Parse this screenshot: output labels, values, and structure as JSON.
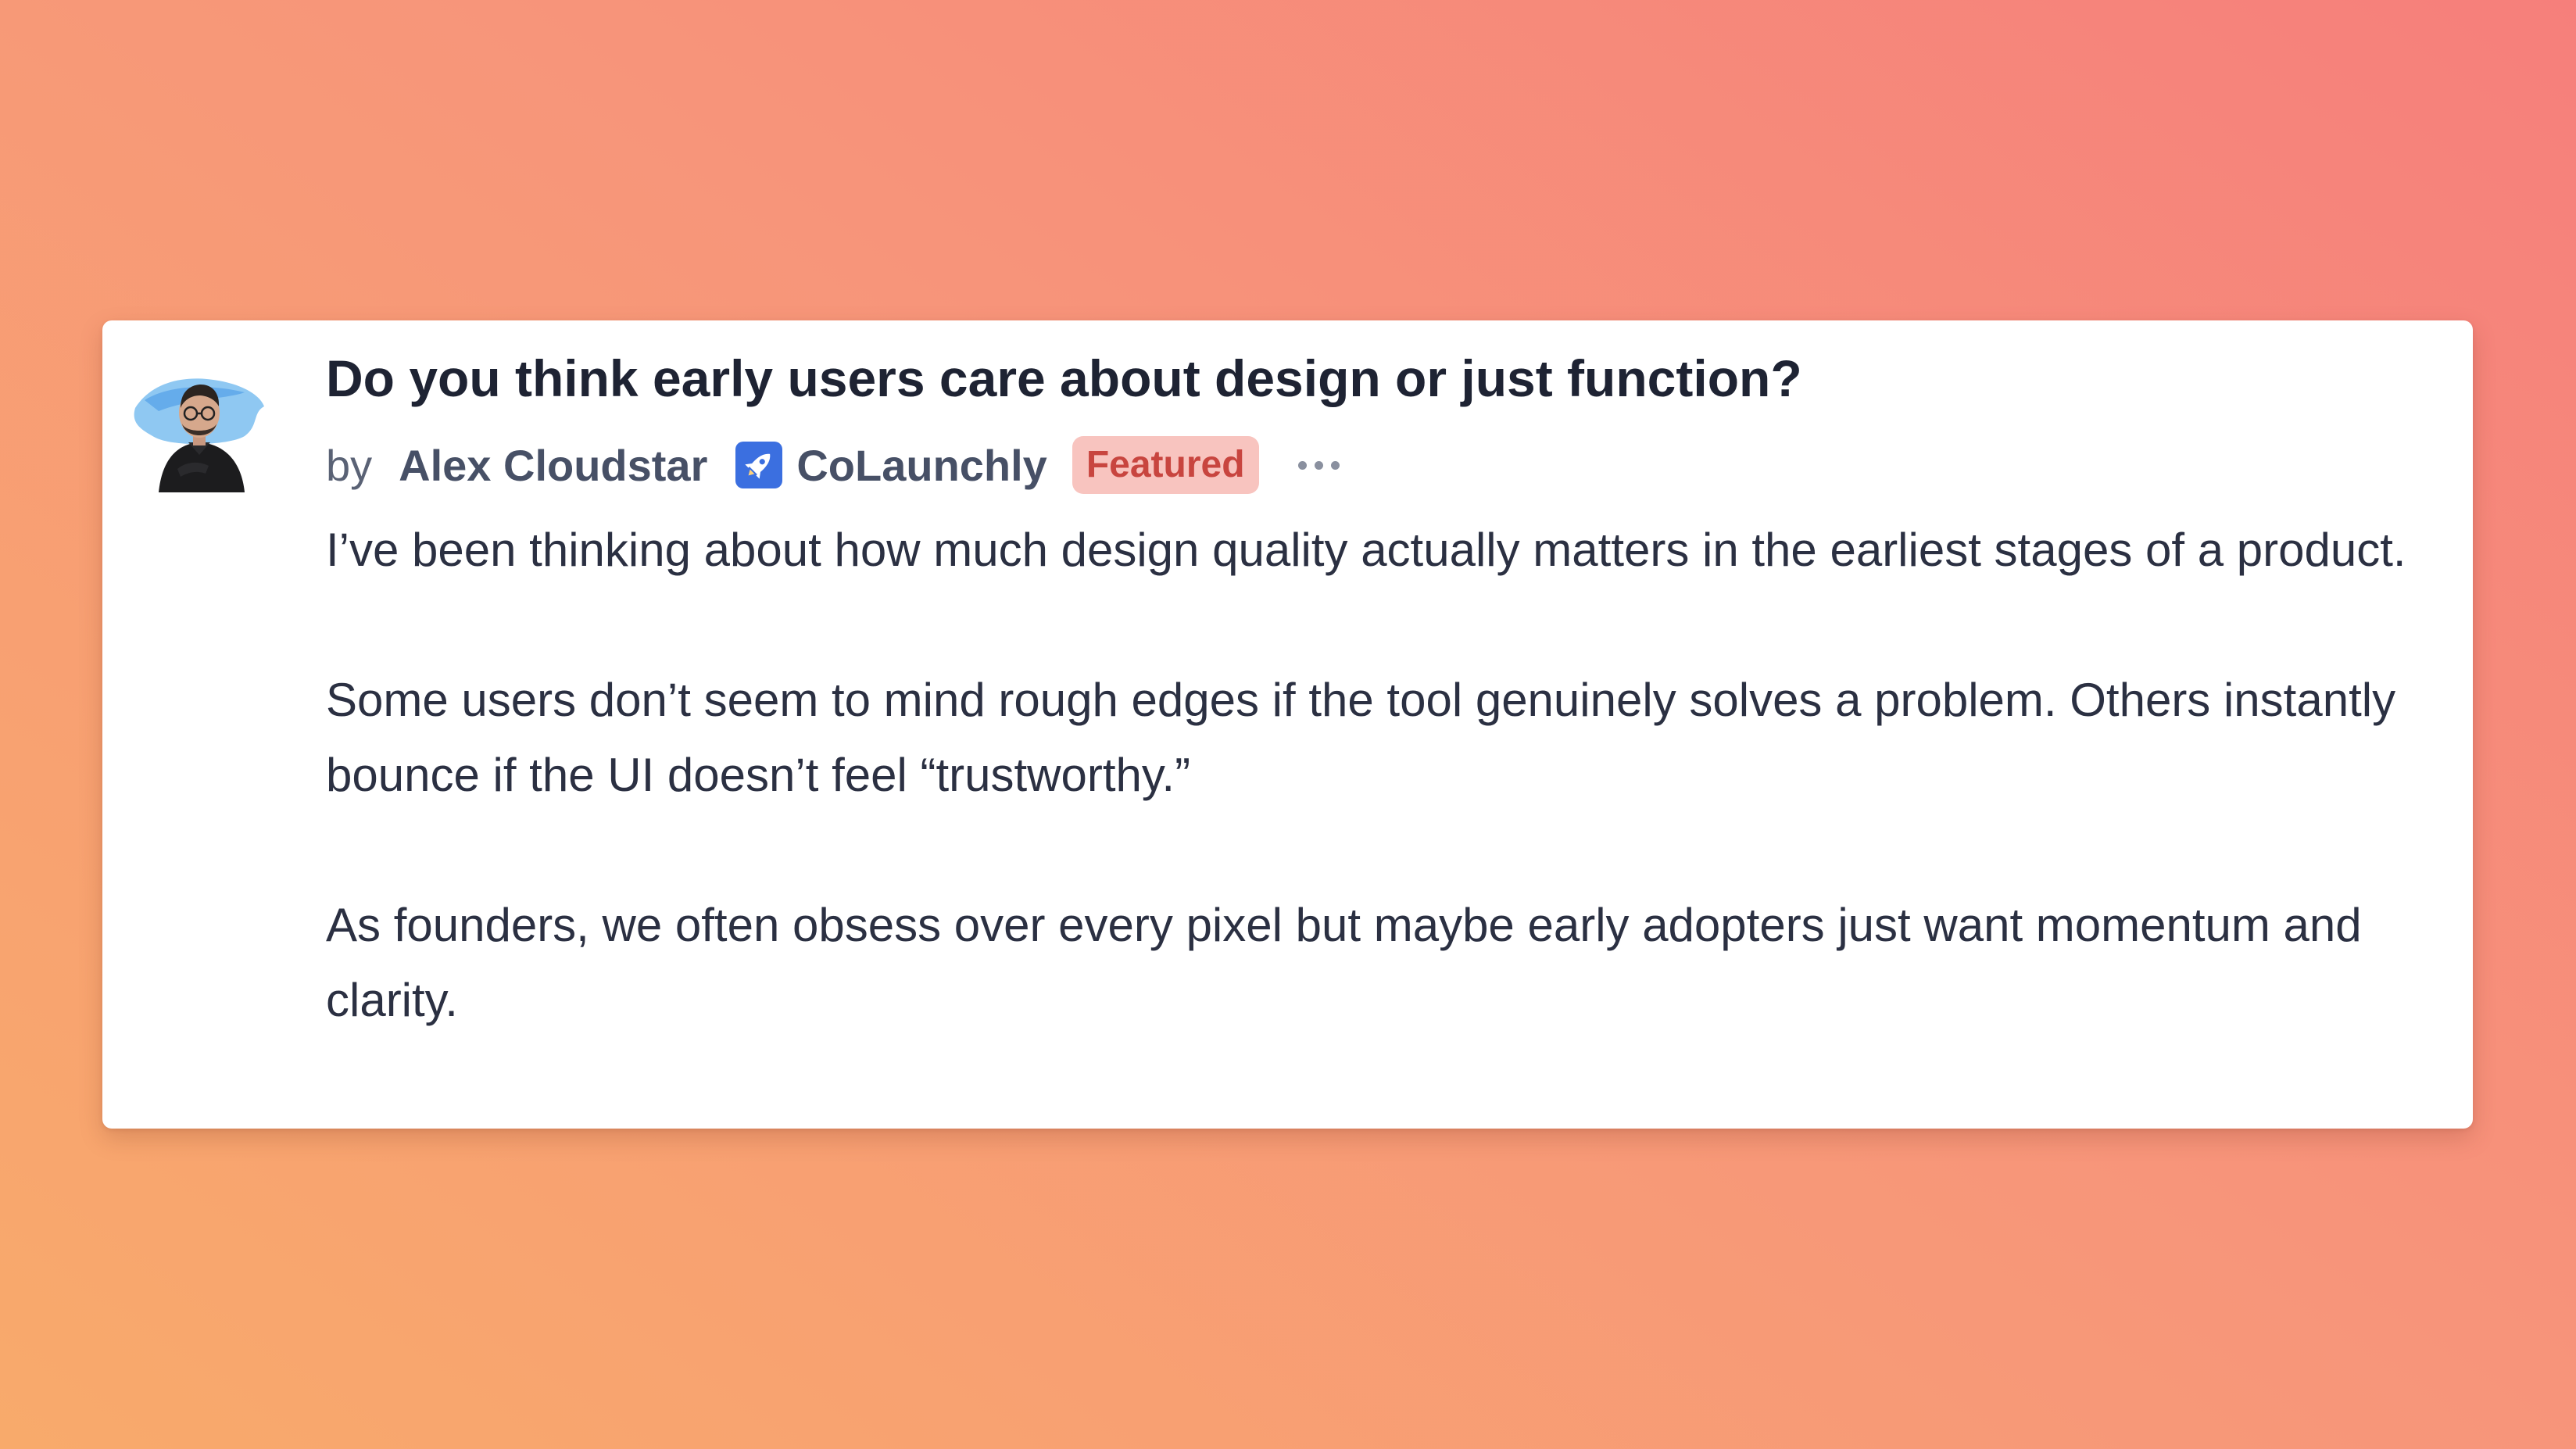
{
  "post": {
    "title": "Do you think early users care about design or just function?",
    "by_label": "by",
    "author": "Alex Cloudstar",
    "org_icon": "rocket-icon",
    "org": "CoLaunchly",
    "badge": "Featured",
    "more_icon": "more-icon",
    "paragraphs": [
      "I’ve been thinking about how much design quality actually matters in the earliest stages of a product.",
      "Some users don’t seem to mind rough edges if the tool genuinely solves a problem. Others in­stantly bounce if the UI doesn’t feel “trustworthy.”",
      "As founders, we often obsess over every pixel but maybe early adopters just want momentum and clarity."
    ]
  },
  "colors": {
    "background_start": "#f8aa6b",
    "background_end": "#f67f7b",
    "badge_bg": "#f8c4bf",
    "badge_text": "#c8453f",
    "org_icon_bg": "#3b6fe0"
  }
}
